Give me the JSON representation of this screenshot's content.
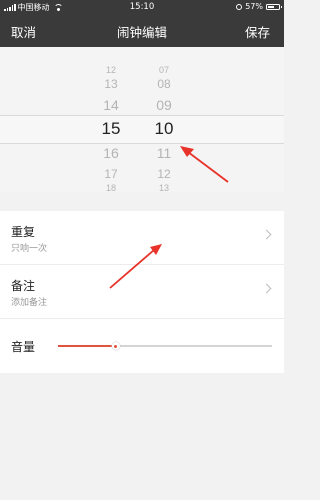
{
  "status_bar": {
    "carrier": "中国移动",
    "time": "15:10",
    "battery": "57%",
    "battery_level": 0.57,
    "icons": [
      "signal-icon",
      "wifi-icon",
      "alarm-icon",
      "battery-icon"
    ]
  },
  "navbar": {
    "cancel_label": "取消",
    "title": "闹钟编辑",
    "save_label": "保存"
  },
  "time_picker": {
    "hours": [
      "12",
      "13",
      "14",
      "15",
      "16",
      "17",
      "18"
    ],
    "minutes": [
      "07",
      "08",
      "09",
      "10",
      "11",
      "12",
      "13"
    ],
    "selected_hour": "15",
    "selected_minute": "10"
  },
  "settings": {
    "repeat": {
      "label": "重复",
      "value": "只响一次"
    },
    "note": {
      "label": "备注",
      "placeholder": "添加备注"
    },
    "volume": {
      "label": "音量",
      "level": 0.27
    }
  },
  "colors": {
    "bar": "#3a3a3a",
    "accent": "#e0533f",
    "annotation_arrow": "#e8322a"
  }
}
